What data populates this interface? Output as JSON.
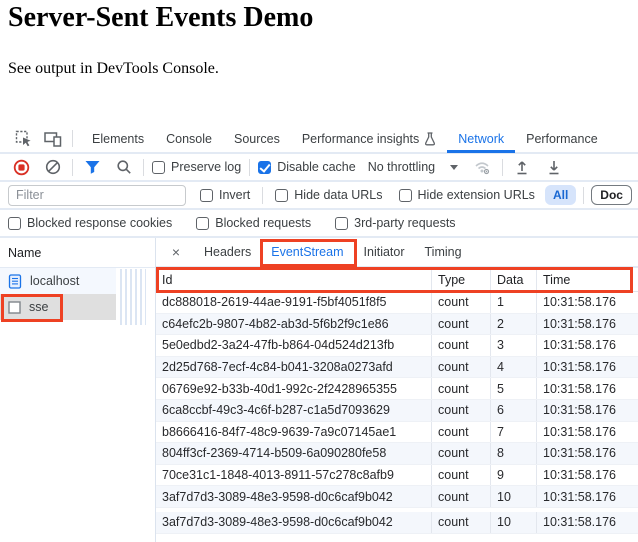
{
  "page": {
    "title": "Server-Sent Events Demo",
    "subtitle": "See output in DevTools Console."
  },
  "devtools": {
    "main_tabs": [
      {
        "label": "Elements"
      },
      {
        "label": "Console"
      },
      {
        "label": "Sources"
      },
      {
        "label": "Performance insights"
      },
      {
        "label": "Network"
      },
      {
        "label": "Performance"
      }
    ],
    "selected_main_tab": "Network",
    "toolbar": {
      "preserve_log_label": "Preserve log",
      "disable_cache_label": "Disable cache",
      "throttling_value": "No throttling"
    },
    "filter_bar": {
      "placeholder": "Filter",
      "invert_label": "Invert",
      "hide_data_urls_label": "Hide data URLs",
      "hide_extension_urls_label": "Hide extension URLs",
      "all_label": "All",
      "doc_label": "Doc"
    },
    "options_bar": {
      "blocked_cookies_label": "Blocked response cookies",
      "blocked_requests_label": "Blocked requests",
      "third_party_label": "3rd-party requests"
    },
    "sidebar": {
      "header": "Name",
      "items": [
        {
          "label": "localhost"
        },
        {
          "label": "sse"
        }
      ],
      "selected_item": "sse"
    },
    "detail": {
      "close_label": "×",
      "tabs": [
        {
          "label": "Headers"
        },
        {
          "label": "EventStream"
        },
        {
          "label": "Initiator"
        },
        {
          "label": "Timing"
        }
      ],
      "selected_tab": "EventStream"
    },
    "table": {
      "columns": [
        "Id",
        "Type",
        "Data",
        "Time"
      ],
      "rows": [
        [
          "dc888018-2619-44ae-9191-f5bf4051f8f5",
          "count",
          "1",
          "10:31:58.176"
        ],
        [
          "c64efc2b-9807-4b82-ab3d-5f6b2f9c1e86",
          "count",
          "2",
          "10:31:58.176"
        ],
        [
          "5e0edbd2-3a24-47fb-b864-04d524d213fb",
          "count",
          "3",
          "10:31:58.176"
        ],
        [
          "2d25d768-7ecf-4c84-b041-3208a0273afd",
          "count",
          "4",
          "10:31:58.176"
        ],
        [
          "06769e92-b33b-40d1-992c-2f2428965355",
          "count",
          "5",
          "10:31:58.176"
        ],
        [
          "6ca8ccbf-49c3-4c6f-b287-c1a5d7093629",
          "count",
          "6",
          "10:31:58.176"
        ],
        [
          "b8666416-84f7-48c9-9639-7a9c07145ae1",
          "count",
          "7",
          "10:31:58.176"
        ],
        [
          "804ff3cf-2369-4714-b509-6a090280fe58",
          "count",
          "8",
          "10:31:58.176"
        ],
        [
          "70ce31c1-1848-4013-8911-57c278c8afb9",
          "count",
          "9",
          "10:31:58.176"
        ],
        [
          "3af7d7d3-3089-48e3-9598-d0c6caf9b042",
          "count",
          "10",
          "10:31:58.176"
        ],
        [
          "3af7d7d3-3089-48e3-9598-d0c6caf9b042",
          "count",
          "10",
          "10:31:58.176"
        ]
      ]
    },
    "colors": {
      "accent_blue": "#1a73e8",
      "annotation_red": "#ee4123",
      "record_red": "#d93025"
    }
  }
}
